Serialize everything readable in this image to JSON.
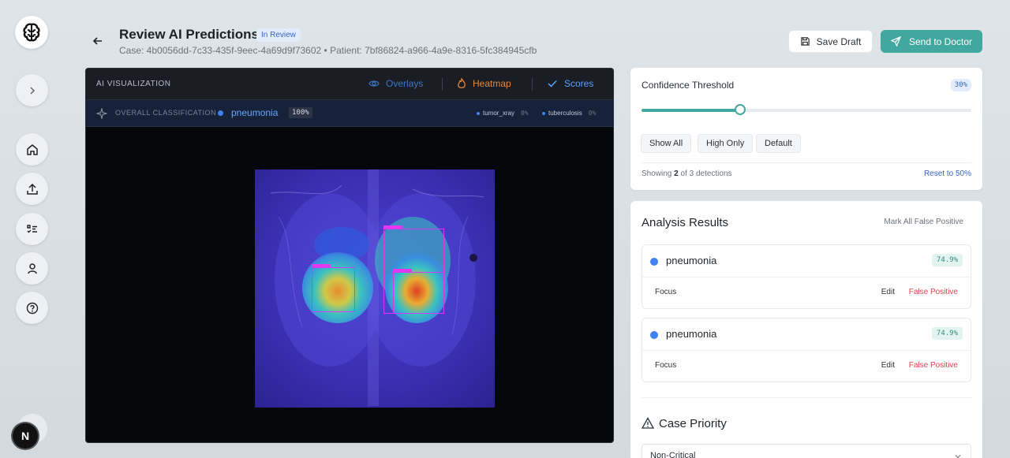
{
  "sidebar": {
    "logo_icon": "brain-icon",
    "buttons": [
      "chevron-right-icon",
      "home-icon",
      "upload-icon",
      "checklist-icon",
      "user-icon",
      "help-icon"
    ],
    "badge": "N"
  },
  "header": {
    "title": "Review AI Predictions",
    "status": "In Review",
    "case_line": "Case: 4b0056dd-7c33-435f-9eec-4a69d9f73602 • Patient: 7bf86824-a966-4a9e-8316-5fc384945cfb",
    "save_label": "Save Draft",
    "send_label": "Send to Doctor",
    "accent": "#41a89f"
  },
  "viz": {
    "label": "AI VISUALIZATION",
    "tabs": [
      {
        "label": "Overlays",
        "icon": "eye-icon",
        "color": "#3f78c8"
      },
      {
        "label": "Heatmap",
        "icon": "flame-icon",
        "color": "#e8883a"
      },
      {
        "label": "Scores",
        "icon": "check-icon",
        "color": "#5aa0ff"
      }
    ],
    "classification_label": "OVERALL CLASSIFICATION",
    "classification": "pneumonia",
    "classification_pct": "100%",
    "others": [
      {
        "name": "tumor_xray",
        "pct": "0%"
      },
      {
        "name": "tuberculosis",
        "pct": "0%"
      }
    ]
  },
  "confidence": {
    "title": "Confidence Threshold",
    "value_label": "30%",
    "value": 0.3,
    "presets": [
      "Show All",
      "High Only",
      "Default"
    ],
    "showing_prefix": "Showing",
    "showing_count": "2",
    "showing_suffix": "of 3 detections",
    "reset_label": "Reset to 50%"
  },
  "results": {
    "title": "Analysis Results",
    "mark_all": "Mark All False Positive",
    "detections": [
      {
        "name": "pneumonia",
        "score": "74.9%",
        "focus": "Focus",
        "edit": "Edit",
        "false_positive": "False Positive"
      },
      {
        "name": "pneumonia",
        "score": "74.9%",
        "focus": "Focus",
        "edit": "Edit",
        "false_positive": "False Positive"
      }
    ],
    "priority_title": "Case Priority",
    "priority_value": "Non-Critical"
  }
}
